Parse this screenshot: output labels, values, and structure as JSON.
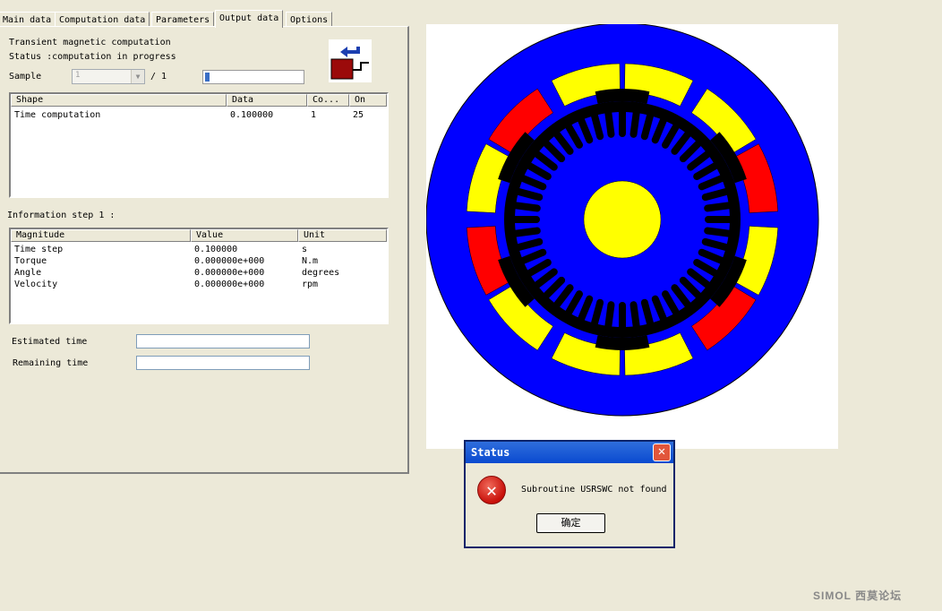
{
  "tabs": [
    "Main data",
    "Computation data",
    "Parameters",
    "Output data",
    "Options"
  ],
  "active_tab": "Output data",
  "header": {
    "title": "Transient magnetic computation",
    "status": "Status :computation in progress",
    "sample_label": "Sample",
    "sample_value": "1",
    "sample_total": "/ 1",
    "progress_fraction": 0.05
  },
  "shape_table": {
    "columns": [
      "Shape",
      "Data",
      "Co...",
      "On"
    ],
    "rows": [
      [
        "Time computation",
        "0.100000",
        "1",
        "25"
      ]
    ]
  },
  "info_label": "Information step 1 :",
  "info_table": {
    "columns": [
      "Magnitude",
      "Value",
      "Unit"
    ],
    "rows": [
      [
        "Time step",
        "0.100000",
        "s"
      ],
      [
        "Torque",
        "0.000000e+000",
        "N.m"
      ],
      [
        "Angle",
        "0.000000e+000",
        "degrees"
      ],
      [
        "Velocity",
        "0.000000e+000",
        "rpm"
      ]
    ]
  },
  "estimated_time_label": "Estimated time",
  "remaining_time_label": "Remaining time",
  "dialog": {
    "title": "Status",
    "message": "Subroutine USRSWC not found",
    "ok_label": "确定",
    "close_glyph": "✕",
    "icon_glyph": "✕"
  },
  "watermark": "SIMOL 西莫论坛",
  "colors": {
    "stator_blue": "#0000ff",
    "coil_yellow": "#ffff00",
    "coil_red": "#ff0000",
    "iron_black": "#000000"
  }
}
